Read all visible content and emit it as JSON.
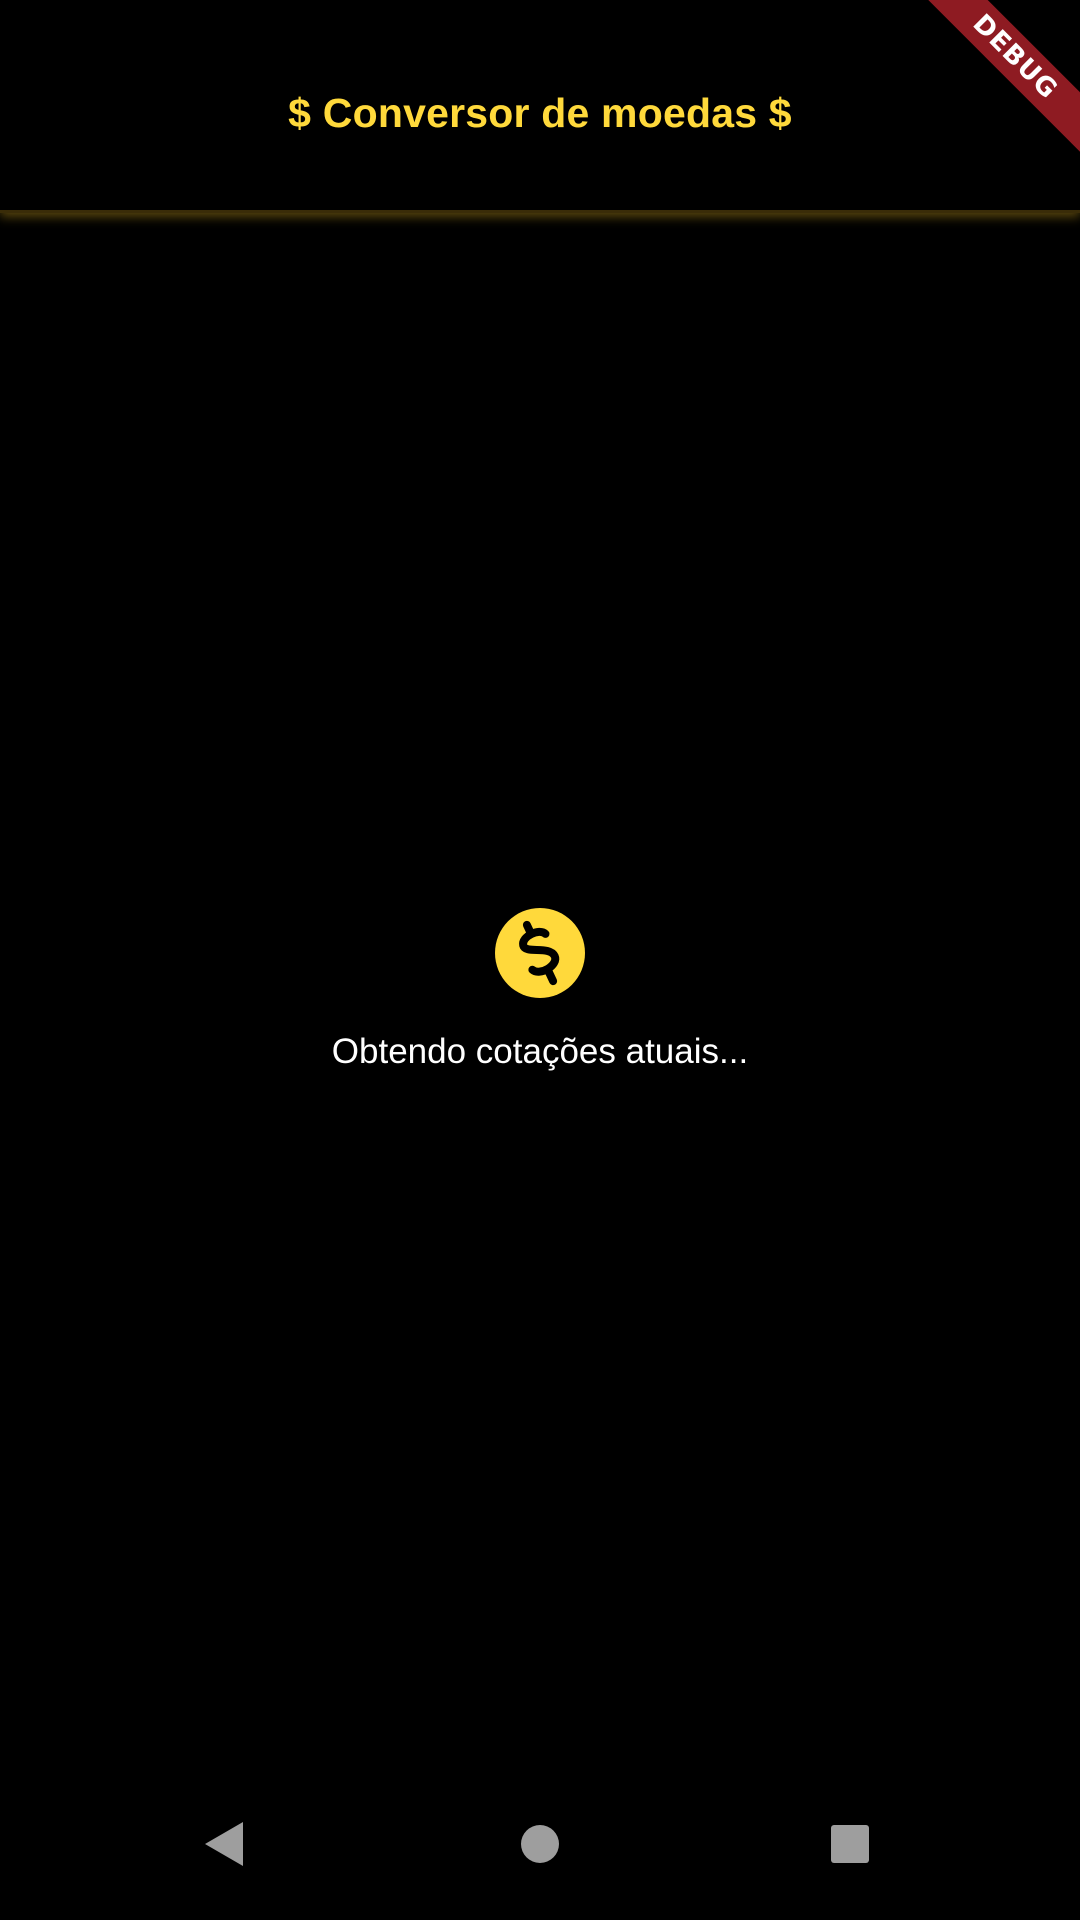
{
  "app_bar": {
    "title": "$ Conversor de moedas $"
  },
  "debug_banner": {
    "label": "DEBUG"
  },
  "loading": {
    "icon": "dollar-coin-icon",
    "message": "Obtendo cotações atuais..."
  },
  "navigation": {
    "back_icon": "back-triangle-icon",
    "home_icon": "home-circle-icon",
    "recents_icon": "recents-square-icon"
  },
  "colors": {
    "background": "#000000",
    "accent": "#FFD93B",
    "text": "#FFFFFF",
    "debug_banner": "#8E1B22",
    "nav_icons": "#9E9E9E"
  }
}
